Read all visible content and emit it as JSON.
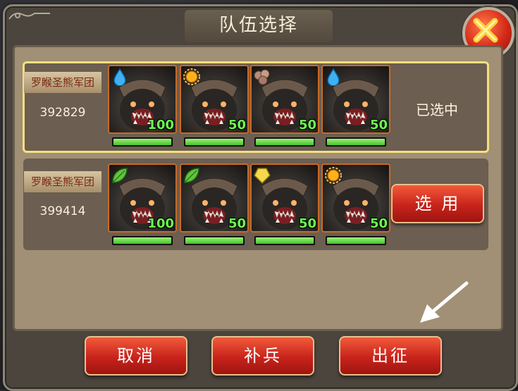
{
  "dialog": {
    "title": "队伍选择",
    "close_icon": "close-icon"
  },
  "teams": [
    {
      "name": "罗睺圣熊军团",
      "power": "392829",
      "status": "已选中",
      "selected": true,
      "units": [
        {
          "element": "water-icon",
          "level": "100",
          "hp_percent": 100
        },
        {
          "element": "sun-icon",
          "level": "50",
          "hp_percent": 100
        },
        {
          "element": "rock-icon",
          "level": "50",
          "hp_percent": 100
        },
        {
          "element": "water-icon",
          "level": "50",
          "hp_percent": 100
        }
      ]
    },
    {
      "name": "罗睺圣熊军团",
      "power": "399414",
      "button": "选 用",
      "selected": false,
      "units": [
        {
          "element": "leaf-icon",
          "level": "100",
          "hp_percent": 100
        },
        {
          "element": "leaf-icon",
          "level": "50",
          "hp_percent": 100
        },
        {
          "element": "gem-icon",
          "level": "50",
          "hp_percent": 100
        },
        {
          "element": "sun-icon",
          "level": "50",
          "hp_percent": 100
        }
      ]
    }
  ],
  "footer": {
    "cancel": "取消",
    "reinforce": "补兵",
    "deploy": "出征"
  },
  "colors": {
    "button_red": "#c8231b",
    "selected_border": "#f3e07f",
    "level_green": "#6cff4f"
  }
}
